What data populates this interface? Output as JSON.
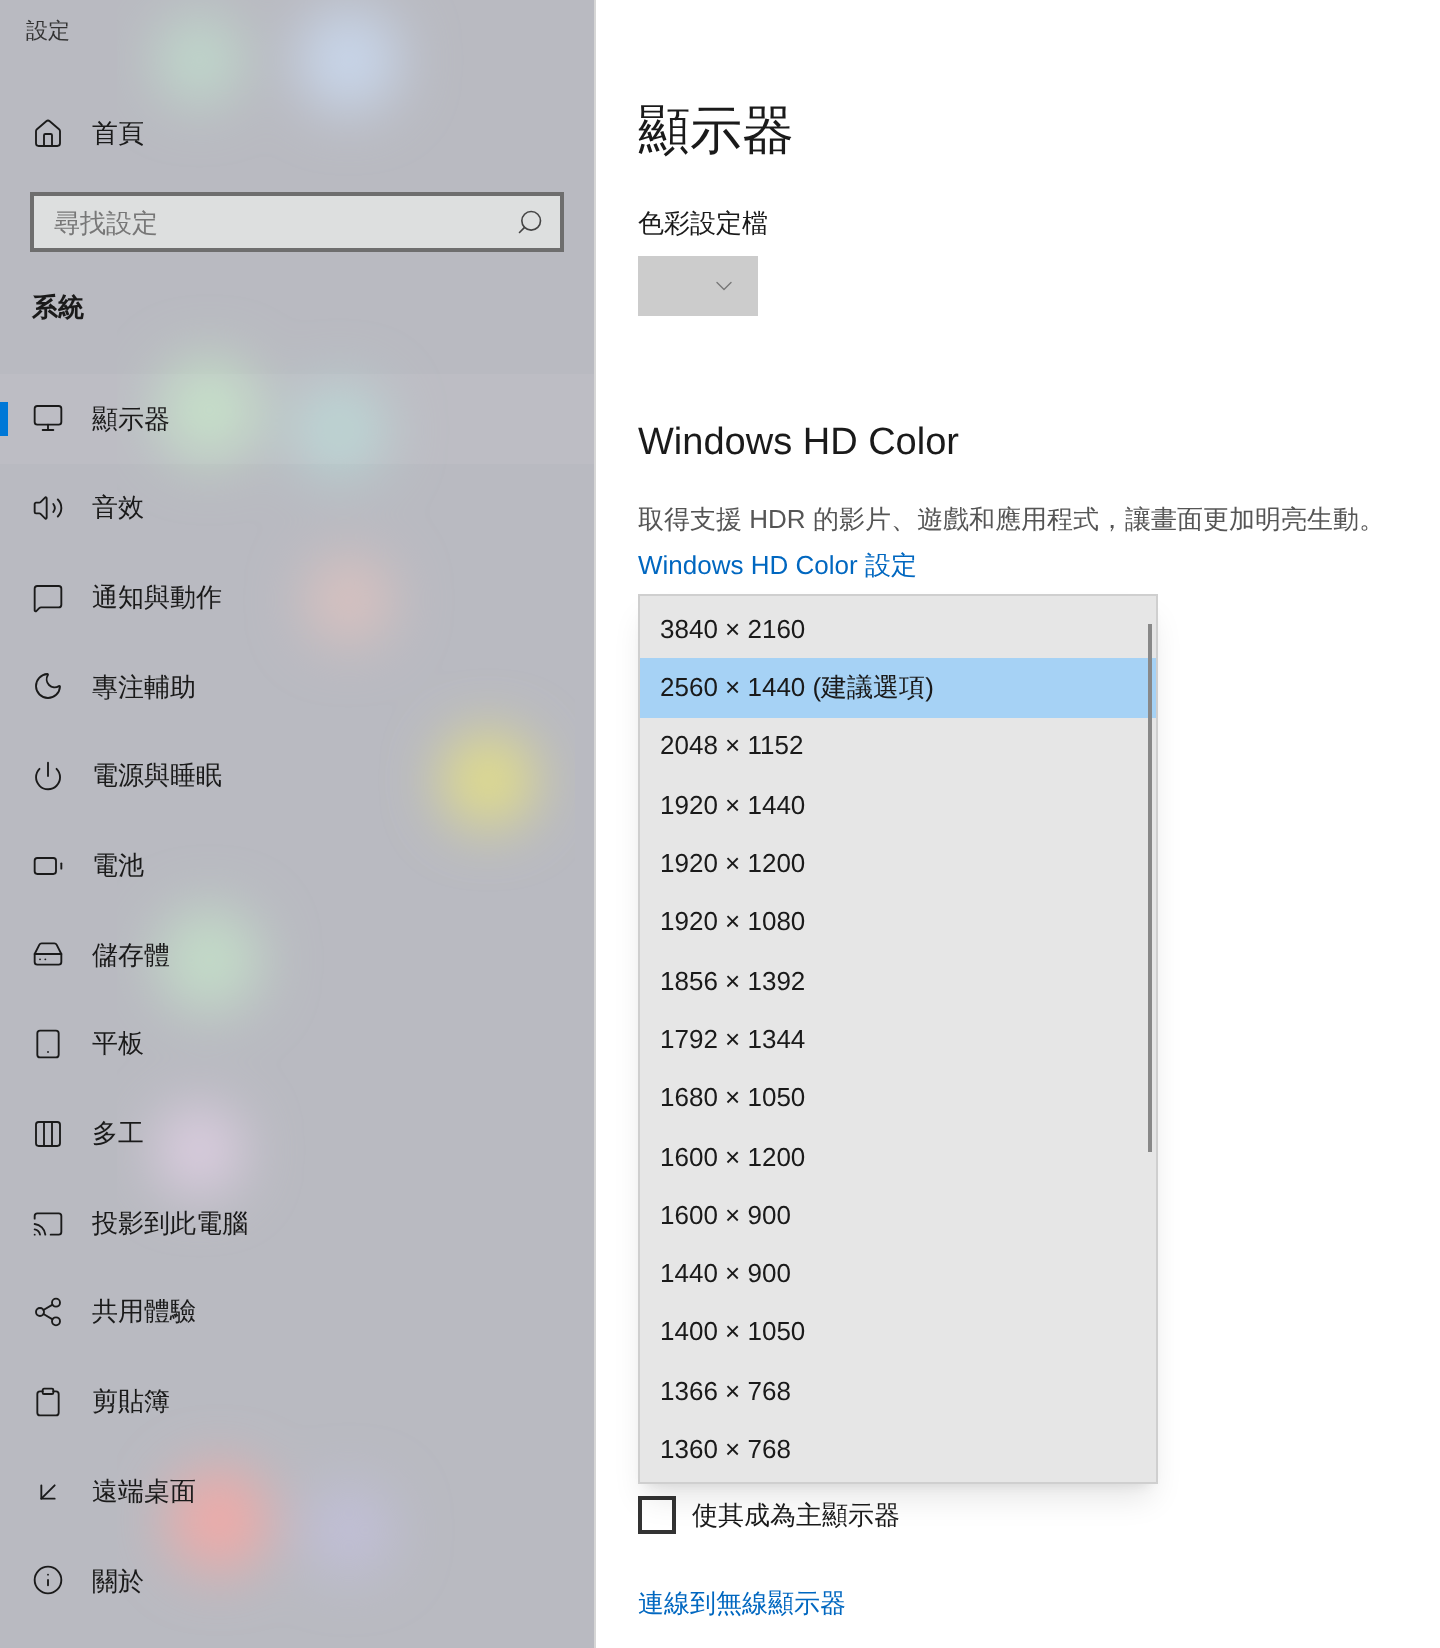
{
  "window": {
    "title": "設定"
  },
  "sidebar": {
    "home": "首頁",
    "search": {
      "placeholder": "尋找設定"
    },
    "section": "系統",
    "items": [
      {
        "label": "顯示器",
        "selected": true
      },
      {
        "label": "音效",
        "selected": false
      },
      {
        "label": "通知與動作",
        "selected": false
      },
      {
        "label": "專注輔助",
        "selected": false
      },
      {
        "label": "電源與睡眠",
        "selected": false
      },
      {
        "label": "電池",
        "selected": false
      },
      {
        "label": "儲存體",
        "selected": false
      },
      {
        "label": "平板",
        "selected": false
      },
      {
        "label": "多工",
        "selected": false
      },
      {
        "label": "投影到此電腦",
        "selected": false
      },
      {
        "label": "共用體驗",
        "selected": false
      },
      {
        "label": "剪貼簿",
        "selected": false
      },
      {
        "label": "遠端桌面",
        "selected": false
      },
      {
        "label": "關於",
        "selected": false
      }
    ]
  },
  "main": {
    "title": "顯示器",
    "color_profile": {
      "label": "色彩設定檔"
    },
    "hd_color": {
      "heading": "Windows HD Color",
      "description": "取得支援 HDR 的影片、遊戲和應用程式，讓畫面更加明亮生動。",
      "link": "Windows HD Color 設定"
    },
    "resolution_menu": [
      {
        "label": "3840 × 2160",
        "selected": false
      },
      {
        "label": "2560 × 1440 (建議選項)",
        "selected": true
      },
      {
        "label": "2048 × 1152",
        "selected": false
      },
      {
        "label": "1920 × 1440",
        "selected": false
      },
      {
        "label": "1920 × 1200",
        "selected": false
      },
      {
        "label": "1920 × 1080",
        "selected": false
      },
      {
        "label": "1856 × 1392",
        "selected": false
      },
      {
        "label": "1792 × 1344",
        "selected": false
      },
      {
        "label": "1680 × 1050",
        "selected": false
      },
      {
        "label": "1600 × 1200",
        "selected": false
      },
      {
        "label": "1600 × 900",
        "selected": false
      },
      {
        "label": "1440 × 900",
        "selected": false
      },
      {
        "label": "1400 × 1050",
        "selected": false
      },
      {
        "label": "1366 × 768",
        "selected": false
      },
      {
        "label": "1360 × 768",
        "selected": false
      }
    ],
    "main_display": {
      "label": "使其成為主顯示器",
      "checked": false
    },
    "wireless_link": "連線到無線顯示器"
  }
}
